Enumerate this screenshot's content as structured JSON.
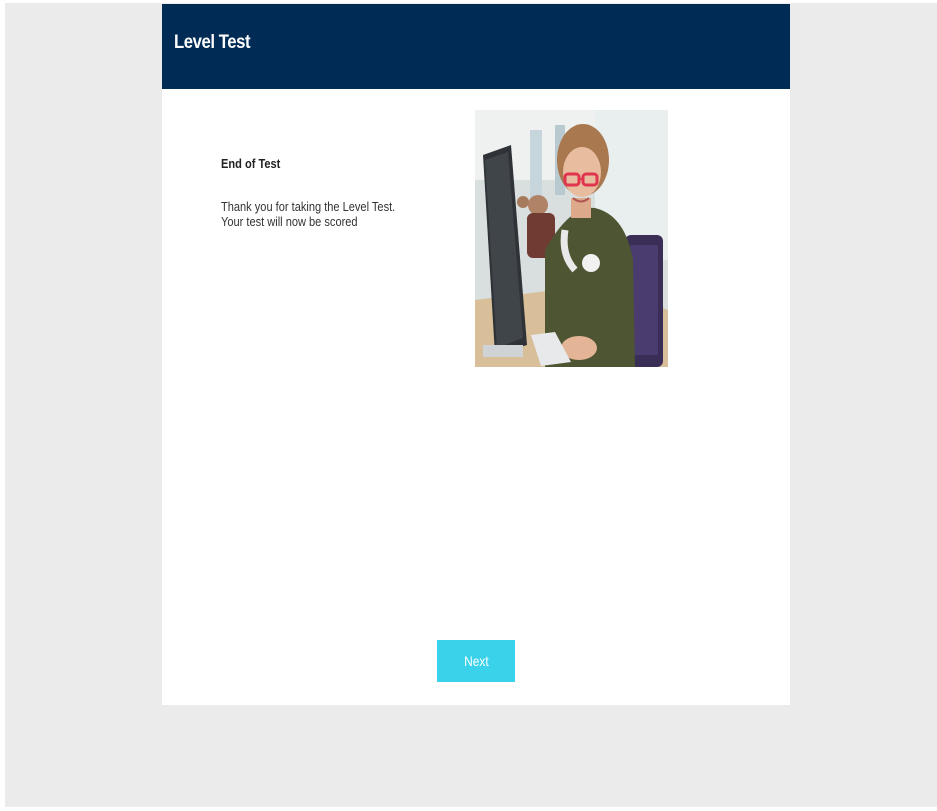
{
  "header": {
    "title": "Level Test"
  },
  "content": {
    "heading": "End of Test",
    "body_lines": [
      "Thank you for taking the Level Test.",
      "Your test will now be scored"
    ]
  },
  "footer": {
    "next_label": "Next"
  },
  "colors": {
    "header_bg": "#002b55",
    "button_bg": "#3ad2ea",
    "page_bg": "#ebebeb"
  },
  "icons": {
    "photo": "student-at-computer-image"
  }
}
